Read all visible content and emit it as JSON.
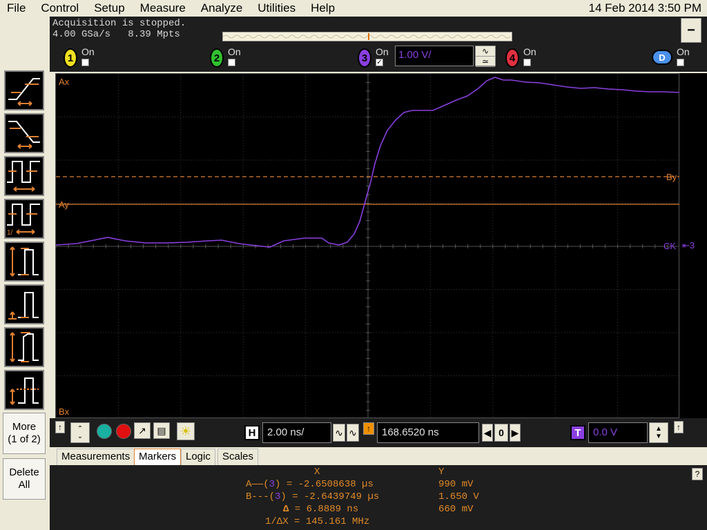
{
  "menu": [
    "File",
    "Control",
    "Setup",
    "Measure",
    "Analyze",
    "Utilities",
    "Help"
  ],
  "clock": "14 Feb 2014  3:50 PM",
  "acquisition": {
    "status": "Acquisition is stopped.",
    "rate": "4.00 GSa/s   8.39 Mpts"
  },
  "channels": [
    {
      "num": "1",
      "label": "On",
      "checked": false,
      "color": "#f0e020"
    },
    {
      "num": "2",
      "label": "On",
      "checked": false,
      "color": "#30c030"
    },
    {
      "num": "3",
      "label": "On",
      "checked": true,
      "color": "#8a3fe0",
      "scale": "1.00 V/"
    },
    {
      "num": "4",
      "label": "On",
      "checked": false,
      "color": "#e03040"
    },
    {
      "num": "D",
      "label": "On",
      "checked": false,
      "color": "#4a90e8"
    }
  ],
  "side": {
    "more": "More",
    "more_page": "(1 of 2)",
    "delete": "Delete",
    "delete2": "All"
  },
  "graticule": {
    "ax": "Ax",
    "bx": "Bx",
    "ay": "Ay",
    "by": "By",
    "ck": "CK",
    "ground": "3"
  },
  "horizontal": {
    "h_label": "H",
    "timebase": "2.00 ns/",
    "delay": "168.6520 ns",
    "zero": "0",
    "t_label": "T",
    "trigger_level": "0.0 V"
  },
  "tabs": [
    "Measurements",
    "Markers",
    "Logic",
    "Scales"
  ],
  "active_tab": "Markers",
  "markers": {
    "x_header": "X",
    "y_header": "Y",
    "a_label": "A——(",
    "a_ch": "3",
    "a_x": ") = -2.6508638 µs",
    "a_y": "990 mV",
    "b_label": "B---(",
    "b_ch": "3",
    "b_x": ") = -2.6439749 µs",
    "b_y": "1.650 V",
    "delta_label": "Δ",
    "delta_x": " = 6.8889 ns",
    "delta_y": "660 mV",
    "inv_label": "1/ΔX",
    "inv_x": " = 145.161 MHz"
  }
}
